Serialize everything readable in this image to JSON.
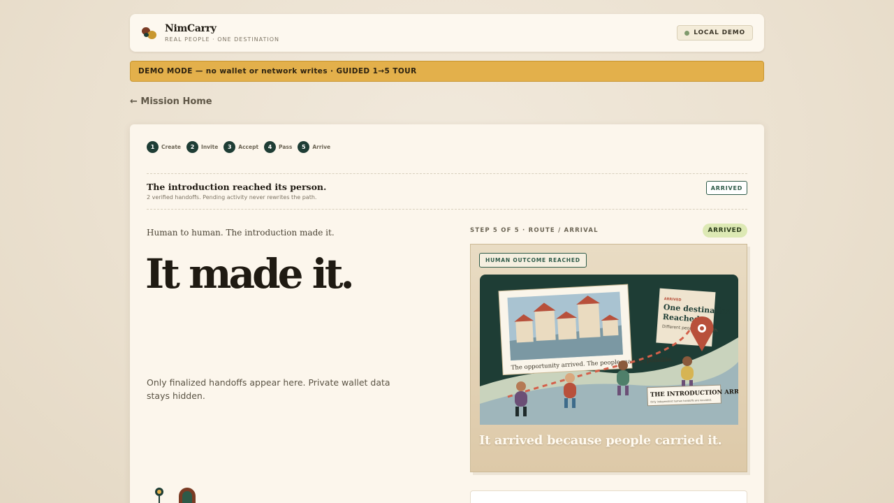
{
  "header": {
    "brand_name": "NimCarry",
    "brand_tagline": "REAL PEOPLE · ONE DESTINATION",
    "status_label": "LOCAL DEMO"
  },
  "banner": {
    "text": "DEMO MODE — no wallet or network writes · GUIDED 1→5 TOUR"
  },
  "back_link": {
    "label": "← Mission Home"
  },
  "steps": [
    {
      "num": "1",
      "label": "Create"
    },
    {
      "num": "2",
      "label": "Invite"
    },
    {
      "num": "3",
      "label": "Accept"
    },
    {
      "num": "4",
      "label": "Pass"
    },
    {
      "num": "5",
      "label": "Arrive"
    }
  ],
  "status": {
    "title": "The introduction reached its person.",
    "subtitle": "2 verified handoffs. Pending activity never rewrites the path.",
    "badge": "ARRIVED"
  },
  "main": {
    "intro": "Human to human. The introduction made it.",
    "headline": "It made it.",
    "note": "Only finalized handoffs appear here. Private wallet data stays hidden."
  },
  "route": {
    "step_meta": "STEP 5 OF 5 · ROUTE / ARRIVAL",
    "pill": "ARRIVED",
    "outcome_tag": "HUMAN OUTCOME REACHED",
    "caption": "It arrived because people carried it.",
    "scene": {
      "photo_caption": "The opportunity arrived. The people made it possible.",
      "note_label": "ARRIVED",
      "note_title_1": "One destination.",
      "note_title_2": "Reached.",
      "note_sub": "Different people, one path.",
      "ticket_title": "THE INTRODUCTION ARRIVED",
      "ticket_sub": "Only independent human handoffs are recorded."
    }
  },
  "colors": {
    "accent_dark": "#1e3d35",
    "banner": "#e3b04b",
    "arrived_pill": "#dde9b4"
  }
}
